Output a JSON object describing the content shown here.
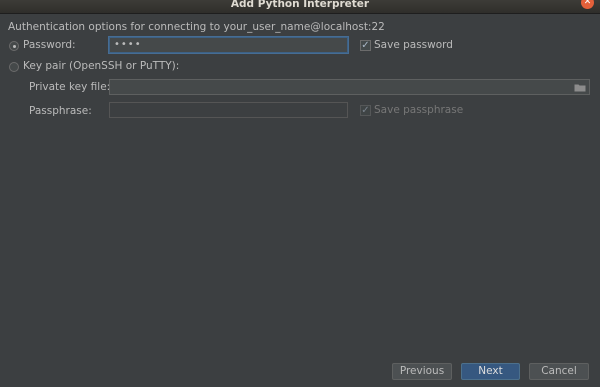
{
  "window": {
    "title": "Add Python Interpreter"
  },
  "auth": {
    "header": "Authentication options for connecting to your_user_name@localhost:22",
    "password_option": {
      "label": "Password:",
      "selected": true,
      "value": "••••"
    },
    "save_password": {
      "label": "Save password",
      "checked": true
    },
    "keypair_option": {
      "label": "Key pair (OpenSSH or PuTTY):",
      "selected": false
    },
    "private_key_file": {
      "label": "Private key file:",
      "value": ""
    },
    "passphrase": {
      "label": "Passphrase:",
      "value": ""
    },
    "save_passphrase": {
      "label": "Save passphrase",
      "checked": true,
      "disabled": true
    }
  },
  "footer": {
    "previous_label": "Previous",
    "next_label": "Next",
    "cancel_label": "Cancel"
  },
  "colors": {
    "background": "#3c3f41",
    "primary_button": "#365880",
    "close_button": "#e4603a"
  }
}
